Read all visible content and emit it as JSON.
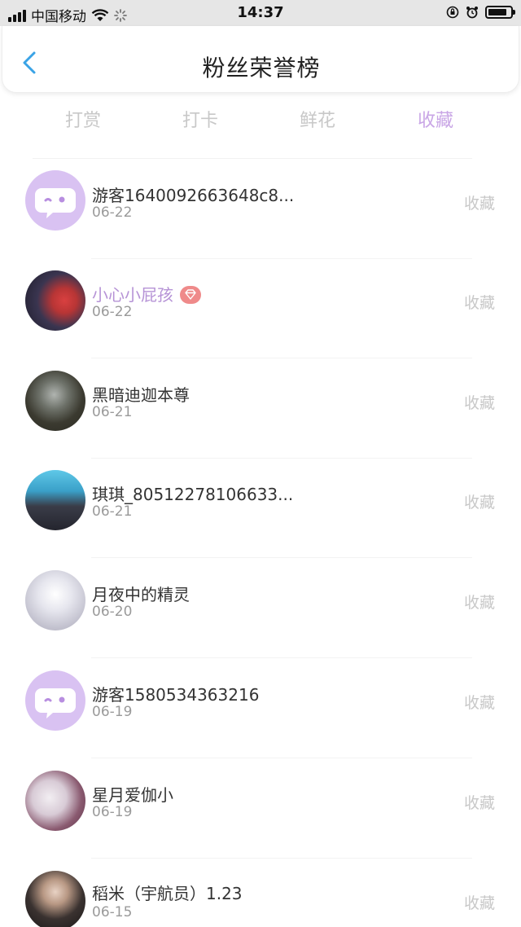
{
  "status_bar": {
    "carrier": "中国移动",
    "time": "14:37",
    "battery_level": 0.85
  },
  "header": {
    "title": "粉丝荣誉榜",
    "back_icon": "chevron-left-icon"
  },
  "tabs": [
    {
      "label": "打赏",
      "active": false
    },
    {
      "label": "打卡",
      "active": false
    },
    {
      "label": "鲜花",
      "active": false
    },
    {
      "label": "收藏",
      "active": true
    }
  ],
  "colors": {
    "accent": "#c9a6e6",
    "vip_name": "#b693d6",
    "badge": "#ef8a8a",
    "back": "#3aa3e6"
  },
  "fans": [
    {
      "name": "游客1640092663648c8...",
      "date": "06-22",
      "action": "收藏",
      "avatar": "guest-chat-avatar",
      "vip": false
    },
    {
      "name": "小心小屁孩",
      "date": "06-22",
      "action": "收藏",
      "avatar": "photo-avatar",
      "vip": true
    },
    {
      "name": "黑暗迪迦本尊",
      "date": "06-21",
      "action": "收藏",
      "avatar": "photo-avatar",
      "vip": false
    },
    {
      "name": "琪琪_80512278106633...",
      "date": "06-21",
      "action": "收藏",
      "avatar": "photo-avatar",
      "vip": false
    },
    {
      "name": "月夜中的精灵",
      "date": "06-20",
      "action": "收藏",
      "avatar": "photo-avatar",
      "vip": false
    },
    {
      "name": "游客1580534363216",
      "date": "06-19",
      "action": "收藏",
      "avatar": "guest-chat-avatar",
      "vip": false
    },
    {
      "name": "星月爱伽小",
      "date": "06-19",
      "action": "收藏",
      "avatar": "photo-avatar",
      "vip": false
    },
    {
      "name": "稻米（宇航员）1.23",
      "date": "06-15",
      "action": "收藏",
      "avatar": "photo-avatar",
      "vip": false
    }
  ]
}
